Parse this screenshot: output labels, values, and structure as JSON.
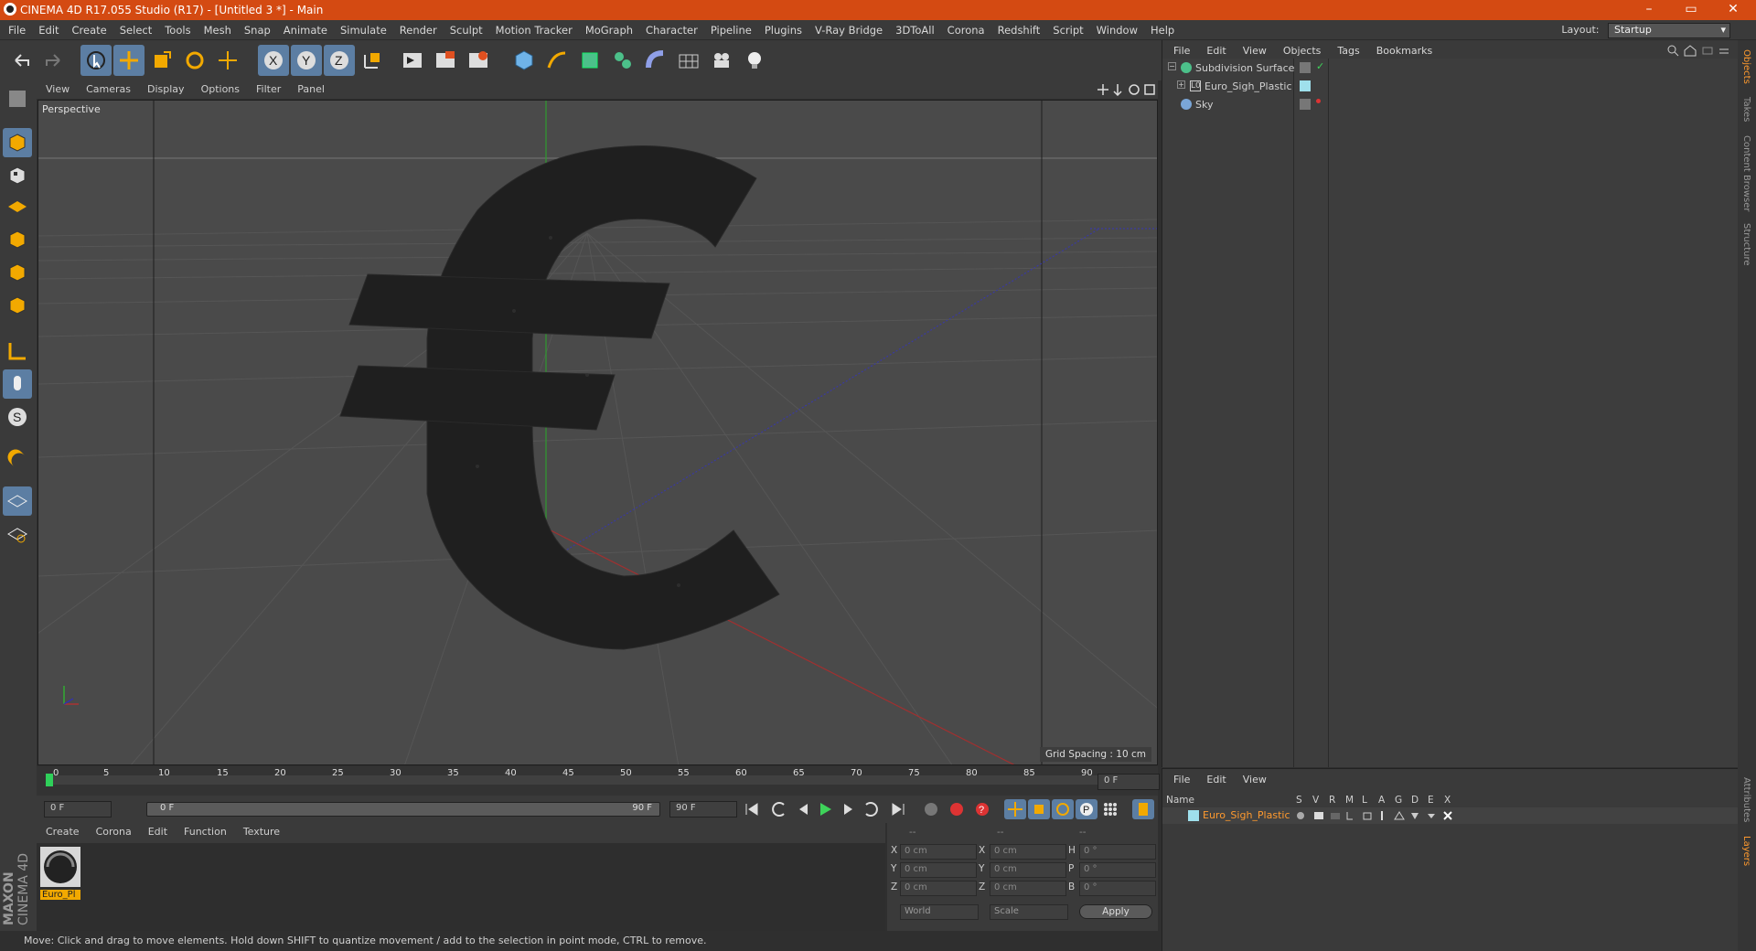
{
  "window": {
    "title": "CINEMA 4D R17.055 Studio (R17) - [Untitled 3 *] - Main",
    "min": "–",
    "max": "▭",
    "close": "✕"
  },
  "menu": [
    "File",
    "Edit",
    "Create",
    "Select",
    "Tools",
    "Mesh",
    "Snap",
    "Animate",
    "Simulate",
    "Render",
    "Sculpt",
    "Motion Tracker",
    "MoGraph",
    "Character",
    "Pipeline",
    "Plugins",
    "V-Ray Bridge",
    "3DToAll",
    "Corona",
    "Redshift",
    "Script",
    "Window",
    "Help"
  ],
  "layout": {
    "label": "Layout:",
    "value": "Startup"
  },
  "viewport": {
    "menu": [
      "View",
      "Cameras",
      "Display",
      "Options",
      "Filter",
      "Panel"
    ],
    "camera_label": "Perspective",
    "grid_spacing": "Grid Spacing : 10 cm"
  },
  "timeline": {
    "ticks": [
      "0",
      "5",
      "10",
      "15",
      "20",
      "25",
      "30",
      "35",
      "40",
      "45",
      "50",
      "55",
      "60",
      "65",
      "70",
      "75",
      "80",
      "85",
      "90"
    ],
    "current_frame": "0 F",
    "start_field": "0 F",
    "slider_start": "0 F",
    "slider_end": "90 F",
    "end_field": "90 F"
  },
  "material_manager": {
    "menu": [
      "Create",
      "Corona",
      "Edit",
      "Function",
      "Texture"
    ],
    "materials": [
      {
        "name": "Euro_Pl"
      }
    ]
  },
  "coordinates": {
    "headers": [
      "--",
      "--",
      "--"
    ],
    "rows": [
      {
        "a": "X",
        "av": "0 cm",
        "b": "X",
        "bv": "0 cm",
        "c": "H",
        "cv": "0 °"
      },
      {
        "a": "Y",
        "av": "0 cm",
        "b": "Y",
        "bv": "0 cm",
        "c": "P",
        "cv": "0 °"
      },
      {
        "a": "Z",
        "av": "0 cm",
        "b": "Z",
        "bv": "0 cm",
        "c": "B",
        "cv": "0 °"
      }
    ],
    "space": "World",
    "mode": "Scale",
    "apply": "Apply"
  },
  "status": "Move: Click and drag to move elements. Hold down SHIFT to quantize movement / add to the selection in point mode, CTRL to remove.",
  "object_manager": {
    "menu": [
      "File",
      "Edit",
      "View",
      "Objects",
      "Tags",
      "Bookmarks"
    ],
    "objects": [
      {
        "name": "Subdivision Surface",
        "color": "#55c08a"
      },
      {
        "name": "Euro_Sigh_Plastic",
        "color": "#aaaaaa"
      },
      {
        "name": "Sky",
        "color": "#7aa6d8"
      }
    ]
  },
  "layer_manager": {
    "menu": [
      "File",
      "Edit",
      "View"
    ],
    "columns": [
      "Name",
      "S",
      "V",
      "R",
      "M",
      "L",
      "A",
      "G",
      "D",
      "E",
      "X"
    ],
    "layers": [
      {
        "name": "Euro_Sigh_Plastic",
        "color": "#4fb3c9"
      }
    ]
  },
  "side_tabs": [
    "Objects",
    "Takes",
    "Content Browser",
    "Structure"
  ],
  "side_tabs_bottom": [
    "Attributes",
    "Layers"
  ],
  "brand": {
    "line1": "MAXON",
    "line2": "CINEMA 4D"
  },
  "colors": {
    "titlebar": "#d44a12",
    "selection_blue": "#5c7ea3",
    "accent_orange": "#ff9a2e"
  }
}
